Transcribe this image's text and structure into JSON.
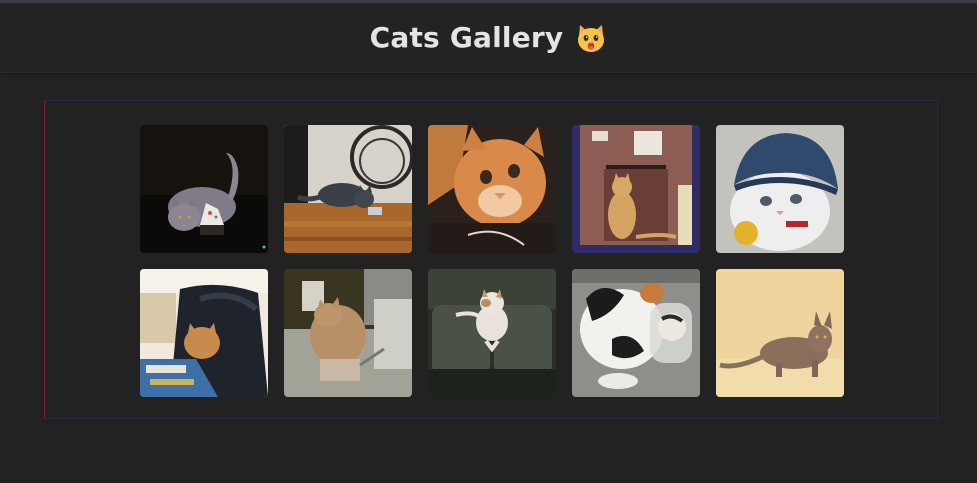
{
  "header": {
    "title": "Cats Gallery",
    "icon": "cat-face-emoji"
  },
  "gallery": {
    "items": [
      {
        "name": "gray-cat-with-cupcake",
        "palette": {
          "bg": "#1b1710",
          "main": "#7e7a86"
        }
      },
      {
        "name": "gray-cat-on-wood-floor",
        "palette": {
          "bg": "#a9672c",
          "main": "#3c4047"
        }
      },
      {
        "name": "orange-kitten-closeup",
        "palette": {
          "bg": "#2a211d",
          "main": "#d9894a"
        }
      },
      {
        "name": "cat-in-cardboard-box",
        "palette": {
          "bg": "#8c5d52",
          "main": "#d1a15f"
        }
      },
      {
        "name": "white-cat-in-blue-hat",
        "palette": {
          "bg": "#c9c9c2",
          "main": "#2f4a6d"
        }
      },
      {
        "name": "cat-in-bag",
        "palette": {
          "bg": "#27282e",
          "main": "#c98a4e"
        }
      },
      {
        "name": "cat-in-sink",
        "palette": {
          "bg": "#3f3b22",
          "main": "#b79067"
        }
      },
      {
        "name": "cat-on-green-sofa",
        "palette": {
          "bg": "#3b4136",
          "main": "#e7e1d9"
        }
      },
      {
        "name": "calico-cat-in-jar",
        "palette": {
          "bg": "#8c8c88",
          "main": "#f2f0ed"
        }
      },
      {
        "name": "brown-cat-on-cream",
        "palette": {
          "bg": "#f0d49d",
          "main": "#8a6f5b"
        }
      }
    ]
  }
}
